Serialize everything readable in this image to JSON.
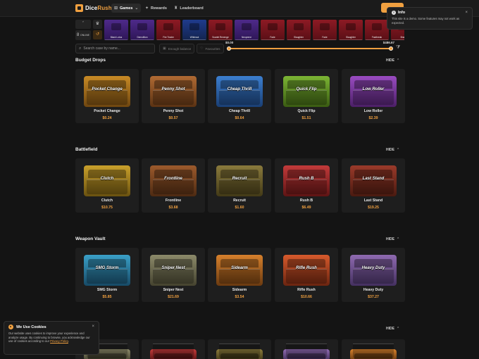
{
  "header": {
    "logo_main": "Dice",
    "logo_accent": "Rush",
    "nav": [
      {
        "label": "Games",
        "icon": "gamepad-icon",
        "glyph": "⊞",
        "caret": "⌄"
      },
      {
        "label": "Rewards",
        "icon": "gift-icon",
        "glyph": "✦"
      },
      {
        "label": "Leaderboard",
        "icon": "trophy-icon",
        "glyph": "♜"
      }
    ]
  },
  "toast": {
    "title": "Info",
    "message": "This site is a demo. Some features may not work as expected.",
    "close": "×"
  },
  "live": {
    "count": "8",
    "label": "ONLINE",
    "drops": [
      {
        "name": "Black Lotus",
        "color": "purple"
      },
      {
        "name": "Demolition",
        "color": "purple"
      },
      {
        "name": "Fire Trader",
        "color": "red"
      },
      {
        "name": "Whiteout",
        "color": "blue"
      },
      {
        "name": "Scarlet Revenge",
        "color": "red"
      },
      {
        "name": "Neoprene",
        "color": "purple"
      },
      {
        "name": "Fade",
        "color": "red"
      },
      {
        "name": "Slaughter",
        "color": "red"
      },
      {
        "name": "Fade",
        "color": "red"
      },
      {
        "name": "Slaughter",
        "color": "red"
      },
      {
        "name": "Fastbreak",
        "color": "red"
      },
      {
        "name": "Bran",
        "color": "red"
      }
    ]
  },
  "filters": {
    "search_placeholder": "Search case by name...",
    "enough_balance": "Enough balance",
    "favourites": "Favourites",
    "price_min": "$0.00",
    "price_max": "$486.67"
  },
  "sections": [
    {
      "title": "Budget Drops",
      "hide_label": "HIDE",
      "cases": [
        {
          "box_label": "Pocket Change",
          "name": "Pocket Change",
          "price": "$0.24",
          "theme": "g-gold"
        },
        {
          "box_label": "Penny Shot",
          "name": "Penny Shot",
          "price": "$0.57",
          "theme": "g-copper"
        },
        {
          "box_label": "Cheap Thrill",
          "name": "Cheap Thrill",
          "price": "$0.64",
          "theme": "g-blue"
        },
        {
          "box_label": "Quick Flip",
          "name": "Quick Flip",
          "price": "$1.51",
          "theme": "g-green"
        },
        {
          "box_label": "Low Roller",
          "name": "Low Roller",
          "price": "$2.39",
          "theme": "g-purple"
        }
      ]
    },
    {
      "title": "Battlefield",
      "hide_label": "HIDE",
      "cases": [
        {
          "box_label": "Clutch",
          "name": "Clutch",
          "price": "$10.75",
          "theme": "g-yellow"
        },
        {
          "box_label": "Frontline",
          "name": "Frontline",
          "price": "$3.68",
          "theme": "g-brown"
        },
        {
          "box_label": "Recruit",
          "name": "Recruit",
          "price": "$1.60",
          "theme": "g-olive"
        },
        {
          "box_label": "Rush B",
          "name": "Rush B",
          "price": "$6.49",
          "theme": "g-red"
        },
        {
          "box_label": "Last Stand",
          "name": "Last Stand",
          "price": "$19.25",
          "theme": "g-darkred"
        }
      ]
    },
    {
      "title": "Weapon Vault",
      "hide_label": "HIDE",
      "cases": [
        {
          "box_label": "SMG Storm",
          "name": "SMG Storm",
          "price": "$5.85",
          "theme": "g-cyan"
        },
        {
          "box_label": "Sniper Nest",
          "name": "Sniper Nest",
          "price": "$21.69",
          "theme": "g-stone"
        },
        {
          "box_label": "Sidearm",
          "name": "Sidearm",
          "price": "$3.54",
          "theme": "g-orange"
        },
        {
          "box_label": "Rifle Rush",
          "name": "Rifle Rush",
          "price": "$10.66",
          "theme": "g-orangered"
        },
        {
          "box_label": "Heavy Duty",
          "name": "Heavy Duty",
          "price": "$37.27",
          "theme": "g-violet"
        }
      ]
    },
    {
      "title": "",
      "hide_label": "HIDE",
      "cases": []
    }
  ],
  "cookie": {
    "title": "We Use Cookies",
    "text": "Our website uses cookies to improve your experience and analyze usage. By continuing to browse, you acknowledge our use of cookies according to our",
    "link": "Privacy Policy",
    "close": "×"
  }
}
